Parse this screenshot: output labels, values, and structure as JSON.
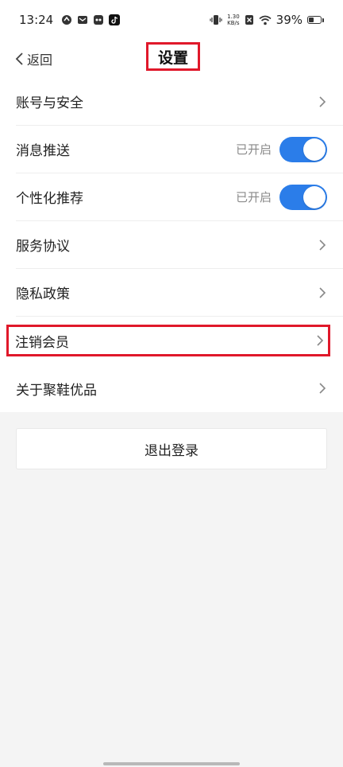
{
  "status_bar": {
    "time": "13:24",
    "net_speed_value": "1.30",
    "net_speed_unit": "KB/s",
    "battery": "39%",
    "icons_left": [
      "app-notification-icon",
      "mail-icon",
      "app-icon",
      "tiktok-icon"
    ],
    "icons_right": [
      "vibrate-icon",
      "network-speed",
      "sim-blocked-icon",
      "wifi-icon",
      "battery-icon"
    ]
  },
  "nav": {
    "back_label": "返回",
    "title": "设置"
  },
  "settings": [
    {
      "label": "账号与安全",
      "type": "link"
    },
    {
      "label": "消息推送",
      "type": "toggle",
      "status": "已开启",
      "on": true
    },
    {
      "label": "个性化推荐",
      "type": "toggle",
      "status": "已开启",
      "on": true
    },
    {
      "label": "服务协议",
      "type": "link"
    },
    {
      "label": "隐私政策",
      "type": "link"
    },
    {
      "label": "注销会员",
      "type": "link",
      "highlighted": true
    },
    {
      "label": "关于聚鞋优品",
      "type": "link"
    }
  ],
  "logout_label": "退出登录",
  "colors": {
    "toggle_on": "#2b7de9",
    "highlight_border": "#e0182a",
    "background": "#f4f4f4"
  }
}
